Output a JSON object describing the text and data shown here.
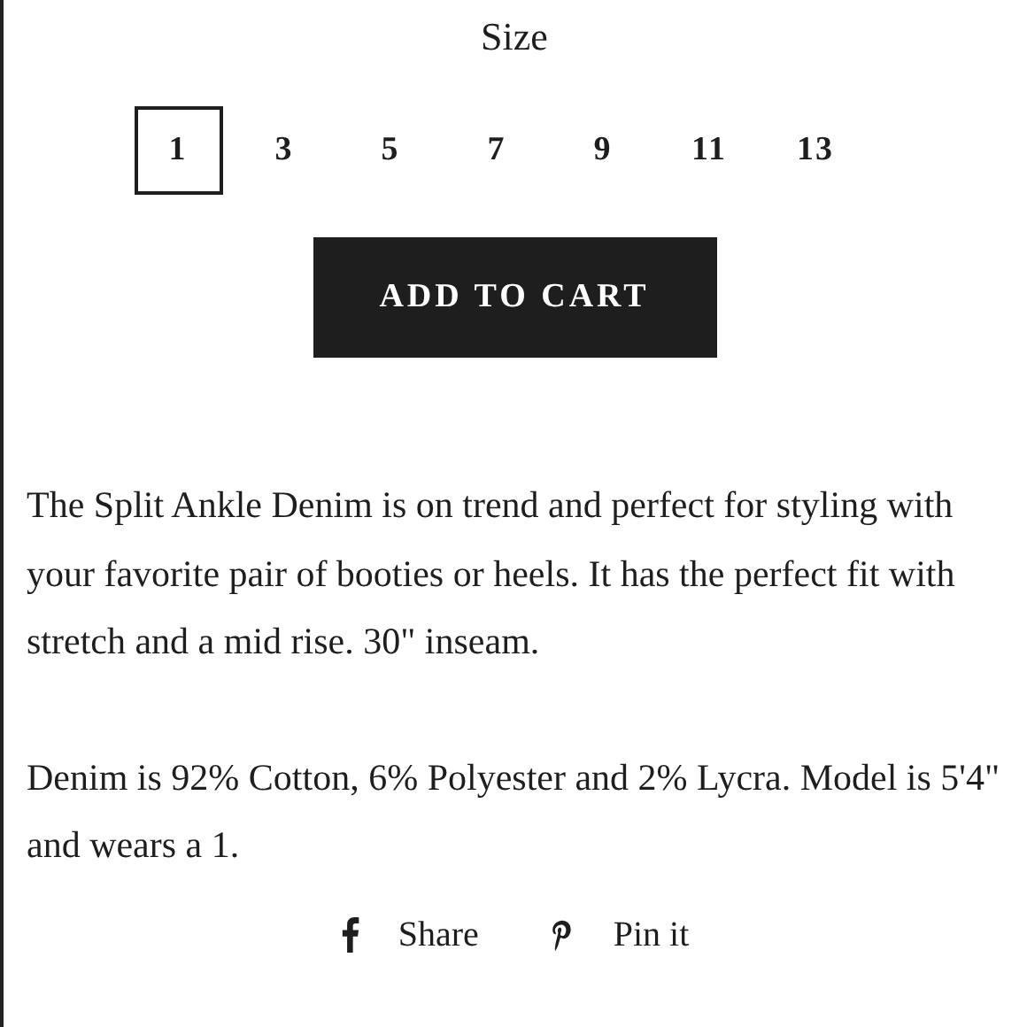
{
  "size_label": "Size",
  "sizes": [
    {
      "label": "1",
      "selected": true
    },
    {
      "label": "3",
      "selected": false
    },
    {
      "label": "5",
      "selected": false
    },
    {
      "label": "7",
      "selected": false
    },
    {
      "label": "9",
      "selected": false
    },
    {
      "label": "11",
      "selected": false
    },
    {
      "label": "13",
      "selected": false
    }
  ],
  "add_to_cart": "ADD TO CART",
  "description": [
    "The Split Ankle Denim is on trend and perfect for styling with your favorite pair of booties or heels. It has the perfect fit with stretch and a mid rise. 30\" inseam.",
    "Denim is 92% Cotton, 6% Polyester and 2% Lycra. Model is 5'4\" and wears a 1."
  ],
  "share_links": [
    {
      "kind": "facebook",
      "label": "Share"
    },
    {
      "kind": "pinterest",
      "label": "Pin it"
    }
  ]
}
